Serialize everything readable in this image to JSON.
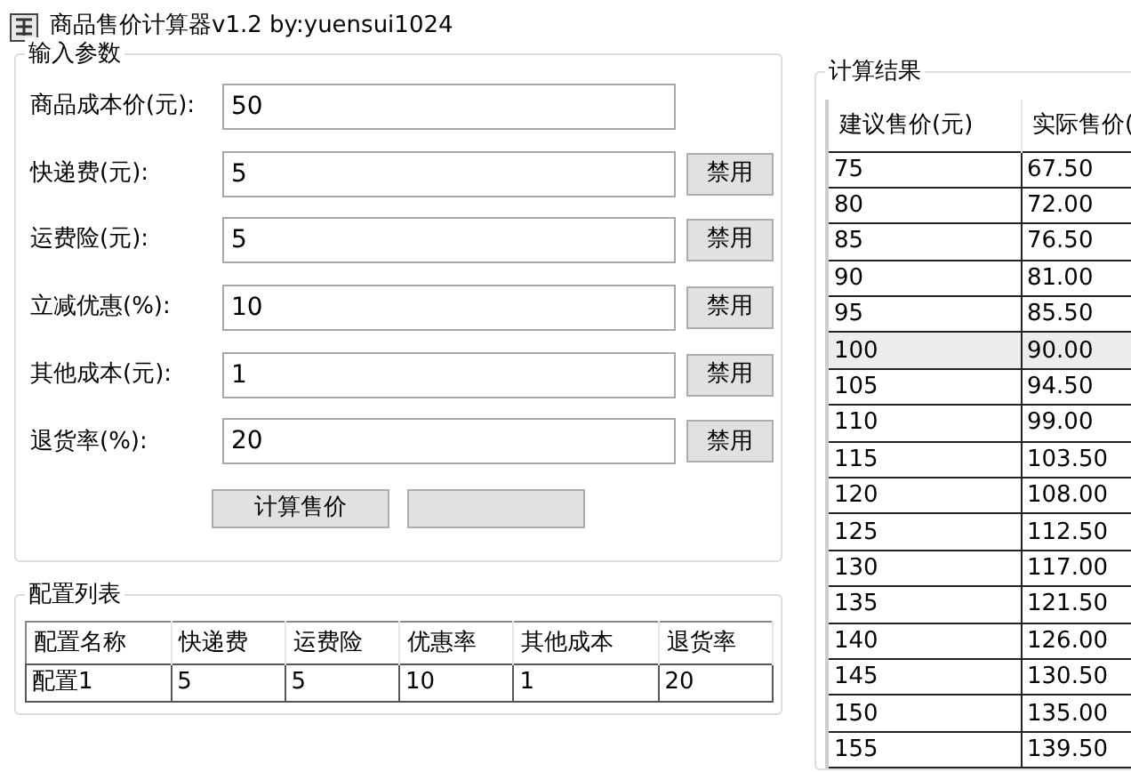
{
  "window": {
    "title": "商品售价计算器v1.2   by:yuensui1024"
  },
  "input_group": {
    "title": "输入参数",
    "fields": [
      {
        "label": "商品成本价(元):",
        "value": "50"
      },
      {
        "label": "快递费(元):",
        "value": "5",
        "button": "禁用"
      },
      {
        "label": "运费险(元):",
        "value": "5",
        "button": "禁用"
      },
      {
        "label": "立减优惠(%):",
        "value": "10",
        "button": "禁用"
      },
      {
        "label": "其他成本(元):",
        "value": "1",
        "button": "禁用"
      },
      {
        "label": "退货率(%):",
        "value": "20",
        "button": "禁用"
      }
    ],
    "buttons": [
      "计算售价"
    ]
  },
  "config_list": {
    "title": "配置列表",
    "columns": [
      "配置名称",
      "快递费",
      "运费险",
      "优惠率",
      "其他成本",
      "退货率"
    ],
    "rows": [
      [
        "配置1",
        "5",
        "5",
        "10",
        "1",
        "20"
      ]
    ]
  },
  "results": {
    "title": "计算结果",
    "columns": [
      "建议售价(元)",
      "实际售价("
    ],
    "rows": [
      {
        "cells": [
          "75",
          "67.50"
        ],
        "selected": false
      },
      {
        "cells": [
          "80",
          "72.00"
        ],
        "selected": false
      },
      {
        "cells": [
          "85",
          "76.50"
        ],
        "selected": false
      },
      {
        "cells": [
          "90",
          "81.00"
        ],
        "selected": false
      },
      {
        "cells": [
          "95",
          "85.50"
        ],
        "selected": false
      },
      {
        "cells": [
          "100",
          "90.00"
        ],
        "selected": true
      },
      {
        "cells": [
          "105",
          "94.50"
        ],
        "selected": false
      },
      {
        "cells": [
          "110",
          "99.00"
        ],
        "selected": false
      },
      {
        "cells": [
          "115",
          "103.50"
        ],
        "selected": false
      },
      {
        "cells": [
          "120",
          "108.00"
        ],
        "selected": false
      },
      {
        "cells": [
          "125",
          "112.50"
        ],
        "selected": false
      },
      {
        "cells": [
          "130",
          "117.00"
        ],
        "selected": false
      },
      {
        "cells": [
          "135",
          "121.50"
        ],
        "selected": false
      },
      {
        "cells": [
          "140",
          "126.00"
        ],
        "selected": false
      },
      {
        "cells": [
          "145",
          "130.50"
        ],
        "selected": false
      },
      {
        "cells": [
          "150",
          "135.00"
        ],
        "selected": false
      },
      {
        "cells": [
          "155",
          "139.50"
        ],
        "selected": false
      }
    ]
  }
}
